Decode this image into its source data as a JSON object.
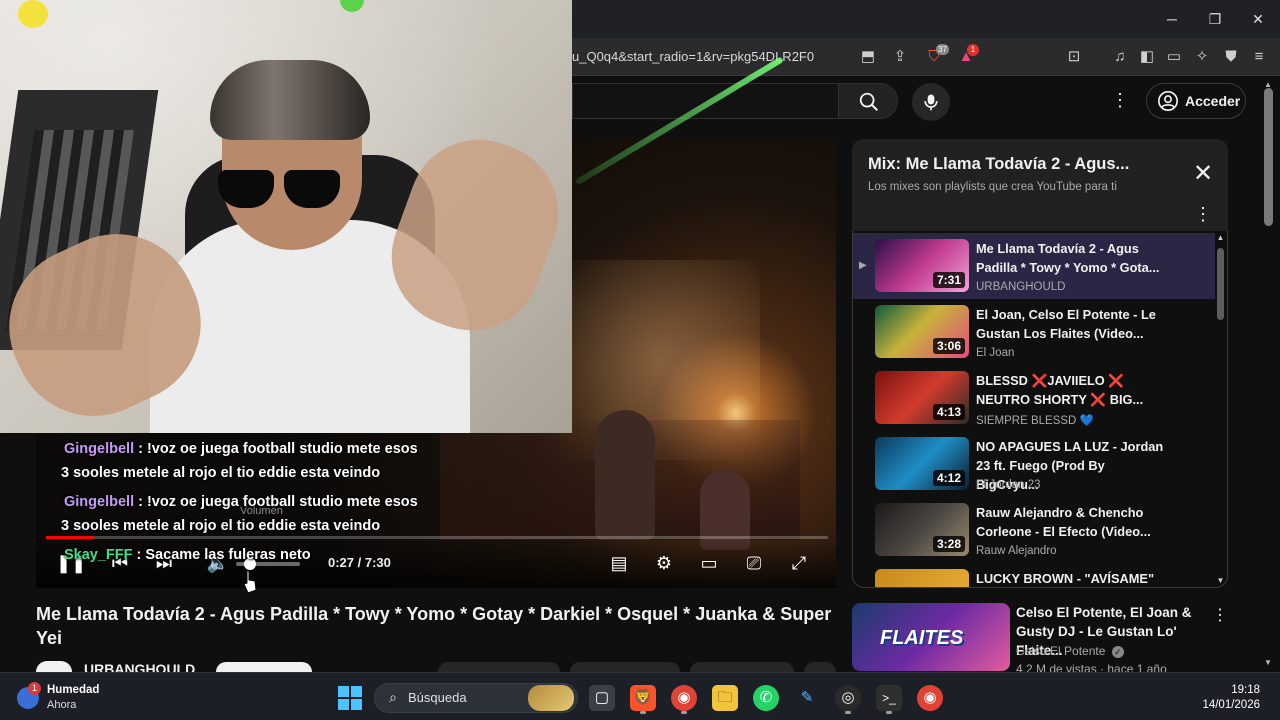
{
  "browser": {
    "url": "u_Q0q4&start_radio=1&rv=pkg54DLR2F0",
    "window_controls": {
      "minimize": "─",
      "maximize": "❐",
      "close": "✕"
    },
    "shield_badge": "37",
    "alert_badge": "1"
  },
  "youtube": {
    "signin_label": "Acceder",
    "video": {
      "time": "0:27 / 7:30",
      "volume_tooltip": "Volumen",
      "progress_fraction": 0.06,
      "title": "Me Llama Todavía 2 - Agus Padilla * Towy * Yomo * Gotay * Darkiel * Osquel * Juanka & Super Yei",
      "channel": "URBANGHOULD"
    },
    "playlist": {
      "title": "Mix: Me Llama Todavía 2 - Agus...",
      "subtitle": "Los mixes son playlists que crea YouTube para ti",
      "items": [
        {
          "title": "Me Llama Todavía 2 - Agus Padilla * Towy * Yomo * Gota...",
          "channel": "URBANGHOULD",
          "duration": "7:31",
          "playing_indicator": "▶"
        },
        {
          "title": "El Joan, Celso El Potente - Le Gustan Los Flaites (Video...",
          "channel": "El Joan",
          "duration": "3:06"
        },
        {
          "title": "BLESSD ❌JAVIIELO ❌ NEUTRO SHORTY ❌ BIG...",
          "channel": "SIEMPRE BLESSD 💙",
          "duration": "4:13"
        },
        {
          "title": "NO APAGUES LA LUZ - Jordan 23 ft. Fuego (Prod By BigCvyu...",
          "channel": "El Jordan 23",
          "duration": "4:12"
        },
        {
          "title": "Rauw Alejandro & Chencho Corleone - El Efecto (Video...",
          "channel": "Rauw Alejandro",
          "duration": "3:28"
        },
        {
          "title": "LUCKY BROWN - \"AVÍSAME\"",
          "channel": "",
          "duration": ""
        }
      ]
    },
    "recommendation": {
      "title": "Celso El Potente, El Joan & Gusty DJ - Le Gustan Lo' Flaite...",
      "channel": "Celso El Potente",
      "meta": "4,2 M de vistas · hace 1 año",
      "thumb_text": "FLAITES"
    }
  },
  "chat": [
    {
      "user": "Gingelbell",
      "text": ": !voz oe juega football studio mete esos",
      "continuation": "3 sooles metele al rojo el tio eddie esta veindo"
    },
    {
      "user": "Gingelbell",
      "text": ": !voz oe juega football studio mete esos",
      "continuation": "3 sooles metele al rojo el tio eddie esta veindo"
    },
    {
      "user": "Skay_FFF",
      "text": ": Sacame las fuleras neto",
      "continuation": ""
    }
  ],
  "taskbar": {
    "weather_title": "Humedad",
    "weather_sub": "Ahora",
    "weather_badge": "1",
    "search_placeholder": "Búsqueda",
    "time": "19:18",
    "date": "14/01/2026",
    "apps": [
      {
        "name": "task-view",
        "glyph": "▢"
      },
      {
        "name": "brave",
        "glyph": "🦁"
      },
      {
        "name": "chrome-profile-j",
        "glyph": "◉"
      },
      {
        "name": "file-explorer",
        "glyph": "🗀"
      },
      {
        "name": "whatsapp",
        "glyph": "✆"
      },
      {
        "name": "pen-app",
        "glyph": "✎"
      },
      {
        "name": "obs",
        "glyph": "◎"
      },
      {
        "name": "terminal",
        "glyph": ">_"
      },
      {
        "name": "chrome",
        "glyph": "◉"
      }
    ]
  },
  "colors": {
    "accent_red": "#ff0000",
    "chat_name_purple": "#c59cf5",
    "chat_name_green": "#3fe08a",
    "taskbar": "#1c1f26"
  }
}
